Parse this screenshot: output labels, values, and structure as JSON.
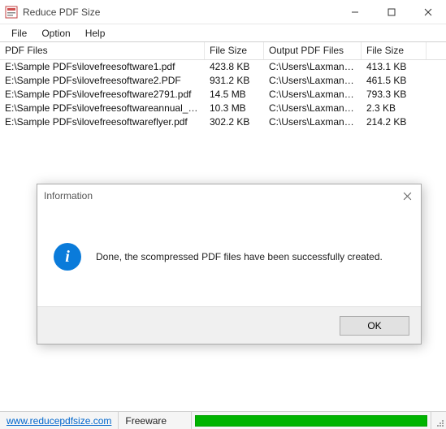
{
  "window": {
    "title": "Reduce PDF Size"
  },
  "menu": {
    "file": "File",
    "option": "Option",
    "help": "Help"
  },
  "columns": {
    "c1": "PDF Files",
    "c2": "File Size",
    "c3": "Output PDF Files",
    "c4": "File Size"
  },
  "rows": [
    {
      "pdf": "E:\\Sample PDFs\\ilovefreesoftware1.pdf",
      "size": "423.8 KB",
      "out": "C:\\Users\\Laxman Si...",
      "osize": "413.1 KB"
    },
    {
      "pdf": "E:\\Sample PDFs\\ilovefreesoftware2.PDF",
      "size": "931.2 KB",
      "out": "C:\\Users\\Laxman Si...",
      "osize": "461.5 KB"
    },
    {
      "pdf": "E:\\Sample PDFs\\ilovefreesoftware2791.pdf",
      "size": "14.5 MB",
      "out": "C:\\Users\\Laxman Si...",
      "osize": "793.3 KB"
    },
    {
      "pdf": "E:\\Sample PDFs\\ilovefreesoftwareannual_re...",
      "size": "10.3 MB",
      "out": "C:\\Users\\Laxman Si...",
      "osize": "2.3 KB"
    },
    {
      "pdf": "E:\\Sample PDFs\\ilovefreesoftwareflyer.pdf",
      "size": "302.2 KB",
      "out": "C:\\Users\\Laxman Si...",
      "osize": "214.2 KB"
    }
  ],
  "status": {
    "link": "www.reducepdfsize.com",
    "freeware": "Freeware",
    "progress_pct": 100
  },
  "dialog": {
    "title": "Information",
    "message": "Done, the scompressed PDF files have been successfully created.",
    "ok": "OK"
  }
}
